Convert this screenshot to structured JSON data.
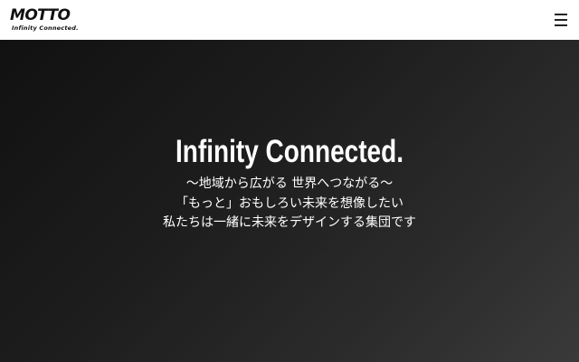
{
  "header": {
    "logo_text": "MOTTO",
    "logo_tagline": "Infinity Connected.",
    "menu_icon": "hamburger-menu-icon"
  },
  "hero": {
    "title": "Infinity Connected.",
    "lines": [
      "〜地域から広がる 世界へつながる〜",
      "「もっと」おもしろい未来を想像したい",
      "私たちは一緒に未来をデザインする集団です"
    ]
  },
  "colors": {
    "header_bg": "#ffffff",
    "logo": "#111111",
    "hero_bg_dark": "#111111",
    "hero_bg_light": "#3a3a3a",
    "hero_text": "#ffffff"
  }
}
